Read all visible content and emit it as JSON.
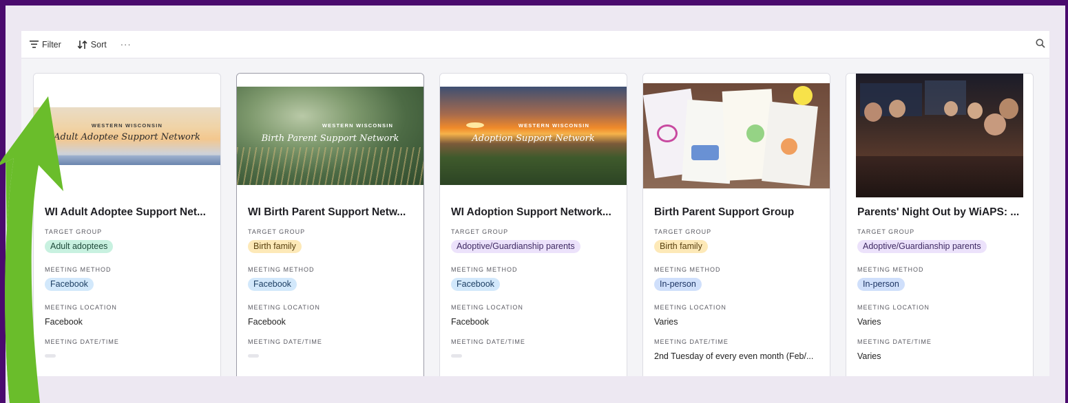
{
  "toolbar": {
    "filter_label": "Filter",
    "sort_label": "Sort",
    "more_label": "···"
  },
  "icons": {
    "filter": "filter-icon",
    "sort": "sort-icon",
    "more": "more-icon",
    "search": "search-icon",
    "arrow": "arrow-up-icon"
  },
  "colors": {
    "frame": "#4a0a6e",
    "arrow": "#6abd2b",
    "pill_green": "#c8f1e0",
    "pill_yellow": "#fde9b8",
    "pill_purple": "#ece2fb",
    "pill_blue": "#d2e8fb",
    "pill_blue_alt": "#cfdffb"
  },
  "labels": {
    "target_group": "TARGET GROUP",
    "meeting_method": "MEETING METHOD",
    "meeting_location": "MEETING LOCATION",
    "meeting_datetime": "MEETING DATE/TIME"
  },
  "cards": [
    {
      "title": "WI Adult Adoptee Support Net...",
      "banner_small": "WESTERN WISCONSIN",
      "banner_script": "Adult Adoptee Support Network",
      "target_group": "Adult adoptees",
      "meeting_method": "Facebook",
      "meeting_location": "Facebook",
      "meeting_datetime": ""
    },
    {
      "title": "WI Birth Parent Support Netw...",
      "banner_small": "WESTERN WISCONSIN",
      "banner_script": "Birth Parent Support Network",
      "target_group": "Birth family",
      "meeting_method": "Facebook",
      "meeting_location": "Facebook",
      "meeting_datetime": ""
    },
    {
      "title": "WI Adoption Support Network...",
      "banner_small": "WESTERN WISCONSIN",
      "banner_script": "Adoption Support Network",
      "target_group": "Adoptive/Guardianship parents",
      "meeting_method": "Facebook",
      "meeting_location": "Facebook",
      "meeting_datetime": ""
    },
    {
      "title": "Birth Parent Support Group",
      "target_group": "Birth family",
      "meeting_method": "In-person",
      "meeting_location": "Varies",
      "meeting_datetime": "2nd Tuesday of every even month (Feb/..."
    },
    {
      "title": "Parents' Night Out by WiAPS: ...",
      "target_group": "Adoptive/Guardianship parents",
      "meeting_method": "In-person",
      "meeting_location": "Varies",
      "meeting_datetime": "Varies"
    }
  ]
}
